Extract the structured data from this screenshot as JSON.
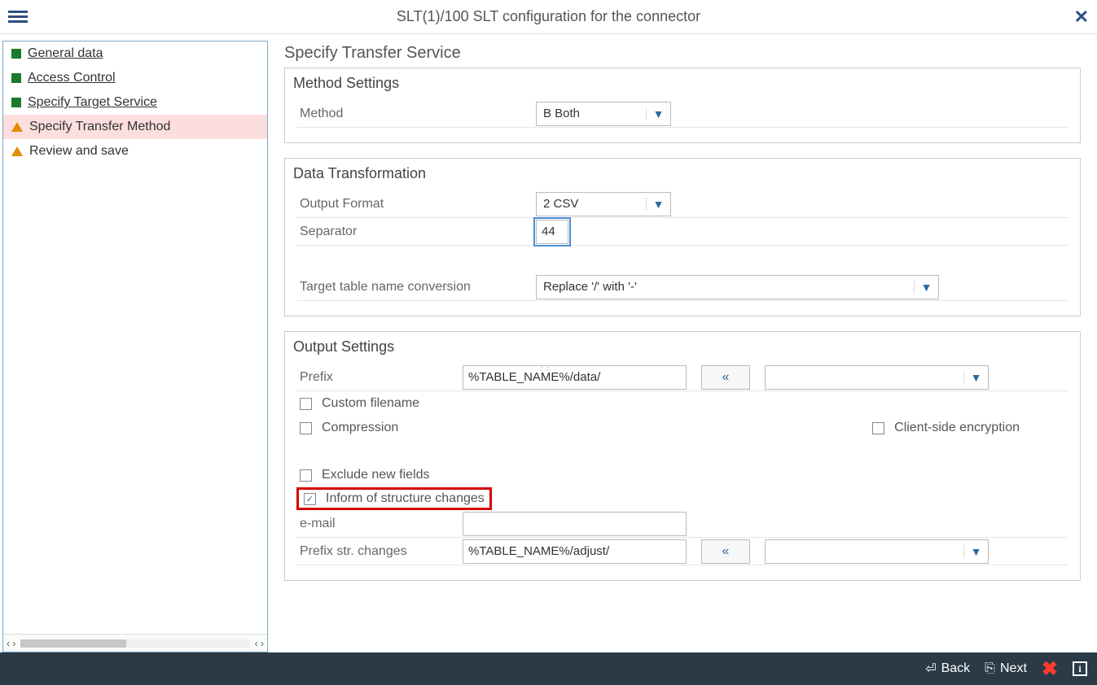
{
  "header": {
    "title": "SLT(1)/100 SLT configuration for the connector"
  },
  "sidebar": {
    "items": [
      {
        "label": "General data",
        "status": "done",
        "link": true
      },
      {
        "label": "Access Control",
        "status": "done",
        "link": true
      },
      {
        "label": "Specify Target  Service",
        "status": "done",
        "link": true
      },
      {
        "label": "Specify Transfer Method",
        "status": "warn",
        "link": false,
        "active": true
      },
      {
        "label": "Review and save",
        "status": "warn",
        "link": false
      }
    ]
  },
  "main": {
    "page_title": "Specify Transfer Service",
    "method_settings": {
      "title": "Method Settings",
      "method_label": "Method",
      "method_value": "B Both"
    },
    "data_transformation": {
      "title": "Data Transformation",
      "output_format_label": "Output Format",
      "output_format_value": "2 CSV",
      "separator_label": "Separator",
      "separator_value": "44",
      "target_table_label": "Target table name conversion",
      "target_table_value": "Replace '/' with '-'"
    },
    "output_settings": {
      "title": "Output Settings",
      "prefix_label": "Prefix",
      "prefix_value": "%TABLE_NAME%/data/",
      "dropdown_value": "",
      "custom_filename_label": "Custom filename",
      "custom_filename_checked": false,
      "compression_label": "Compression",
      "compression_checked": false,
      "client_encryption_label": "Client-side encryption",
      "client_encryption_checked": false,
      "exclude_new_fields_label": "Exclude new fields",
      "exclude_new_fields_checked": false,
      "inform_structure_label": "Inform of structure changes",
      "inform_structure_checked": true,
      "email_label": "e-mail",
      "email_value": "",
      "prefix_str_label": "Prefix str. changes",
      "prefix_str_value": "%TABLE_NAME%/adjust/",
      "dropdown2_value": ""
    }
  },
  "footer": {
    "back": "Back",
    "next": "Next"
  }
}
